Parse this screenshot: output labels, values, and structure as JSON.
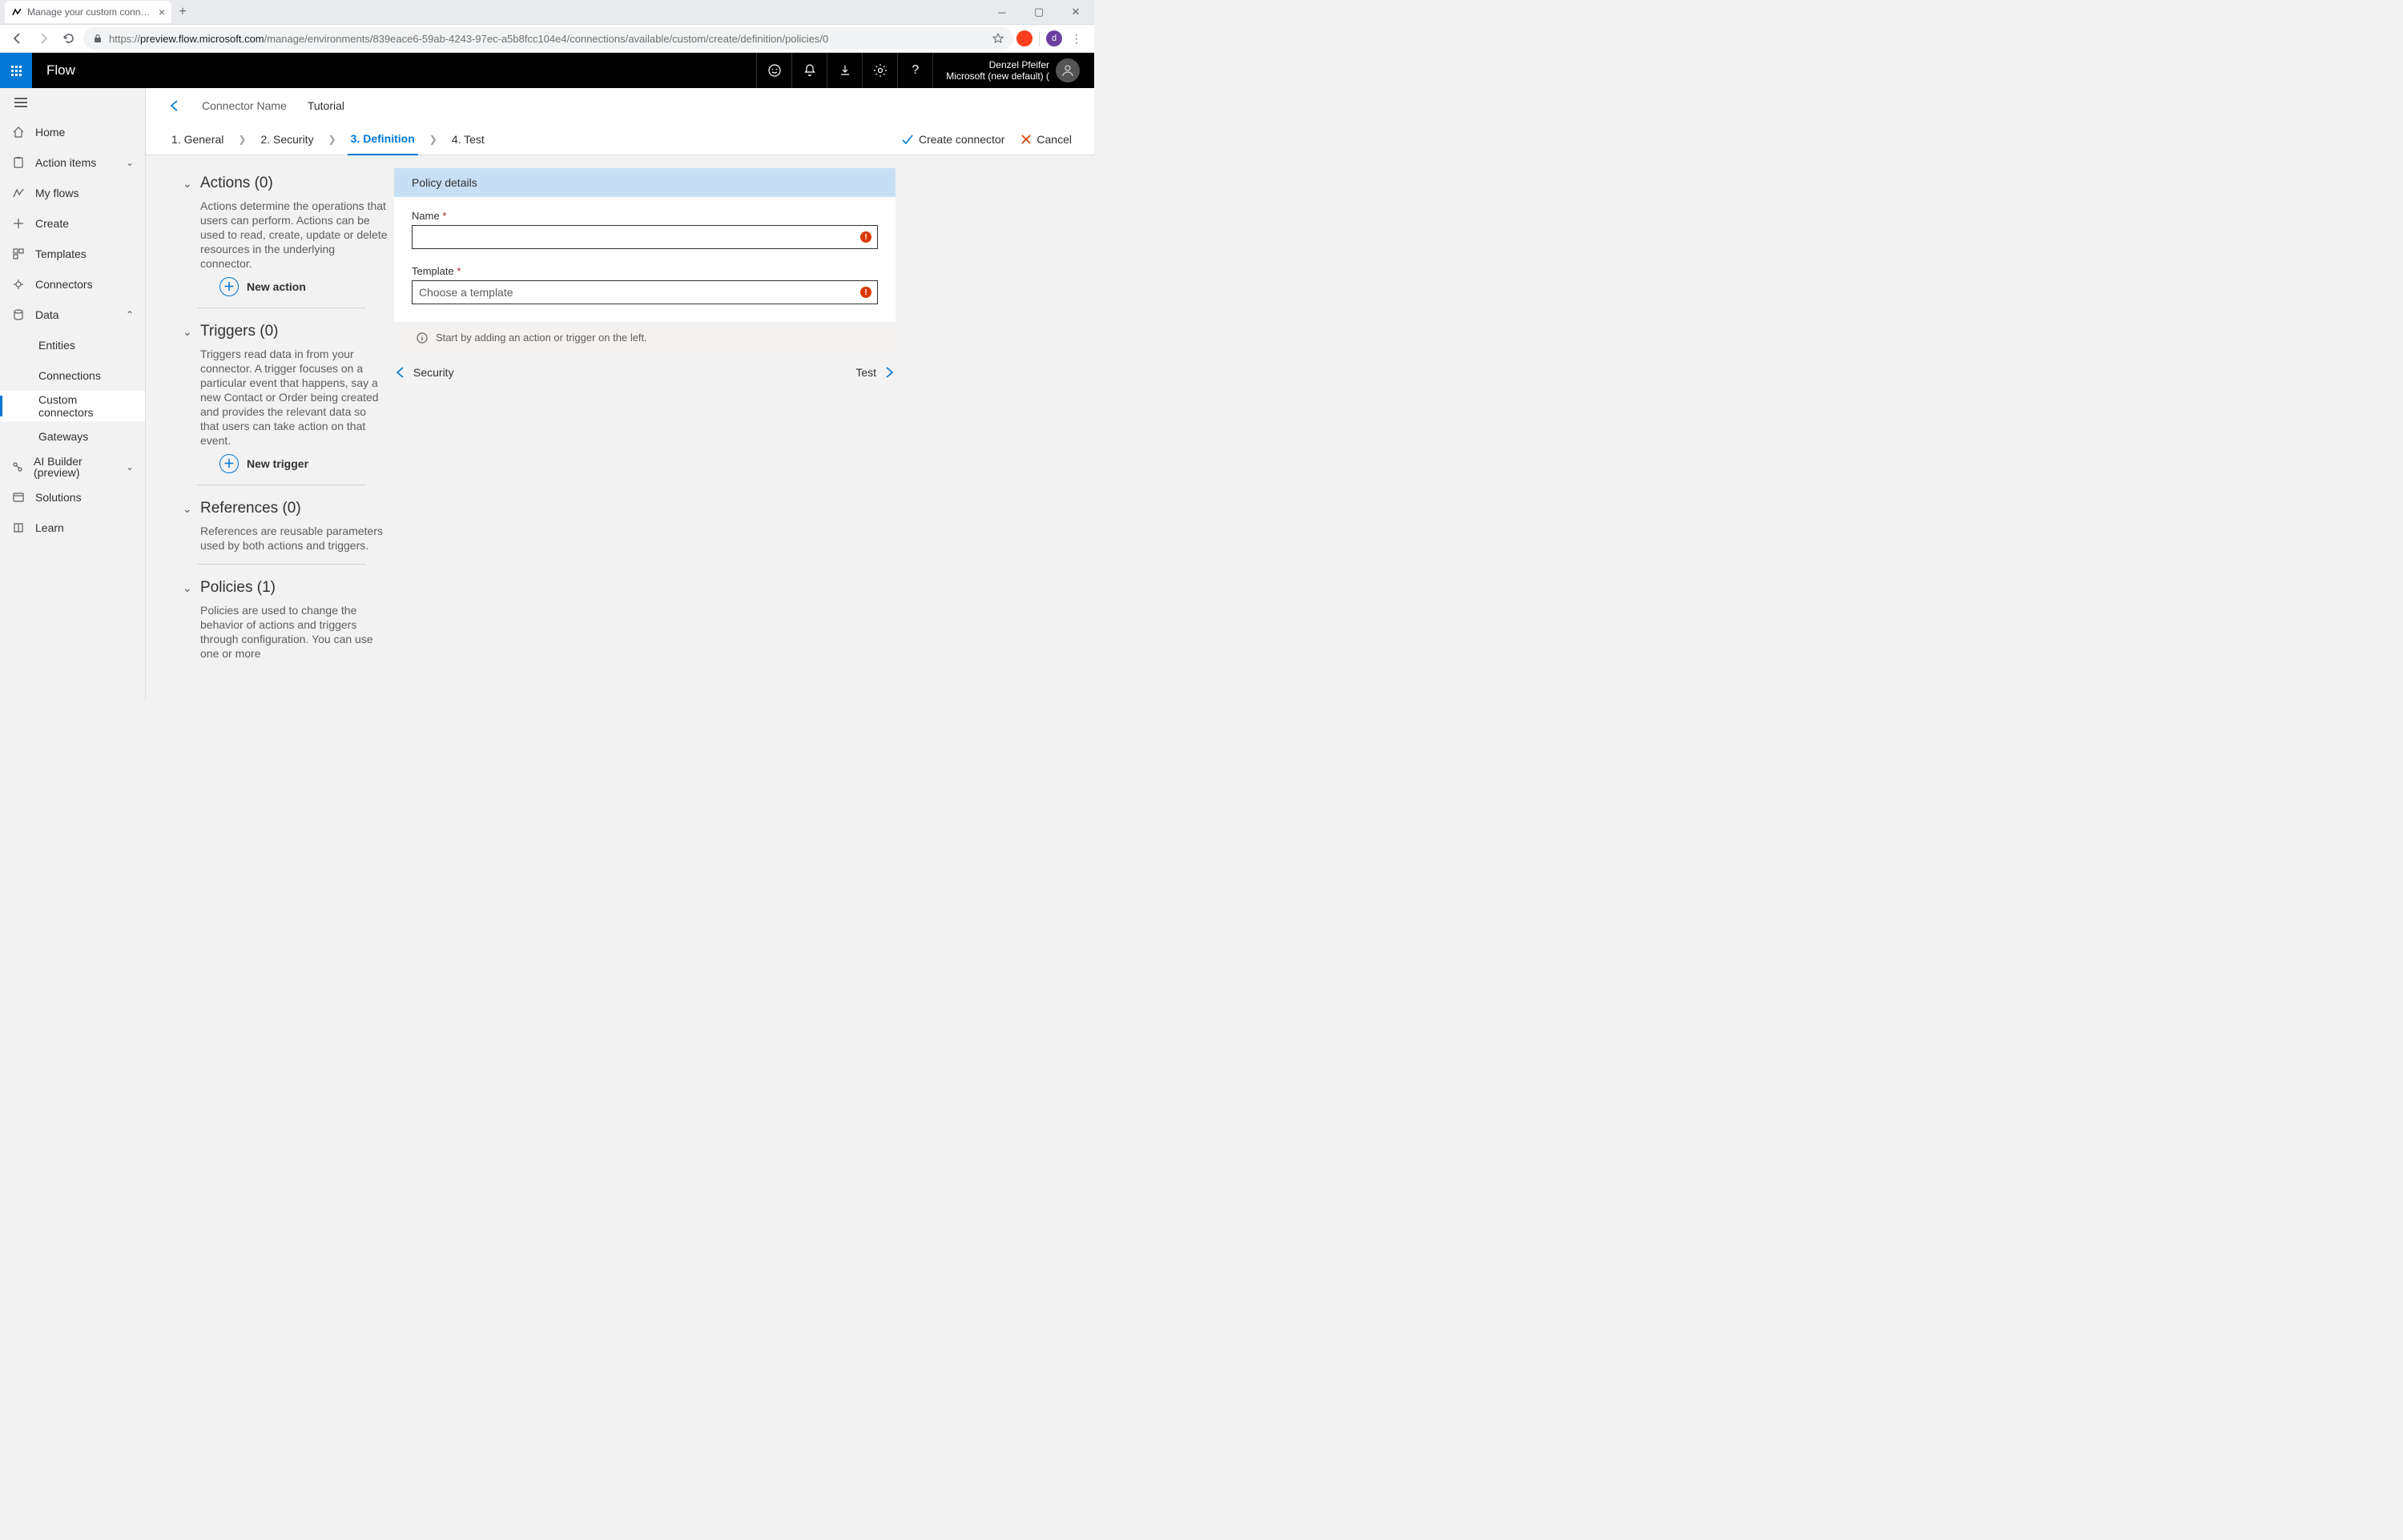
{
  "browser": {
    "tab_title": "Manage your custom connectors",
    "url_prefix": "https://",
    "url_host": "preview.flow.microsoft.com",
    "url_path": "/manage/environments/839eace6-59ab-4243-97ec-a5b8fcc104e4/connections/available/custom/create/definition/policies/0",
    "avatar_initial": "d"
  },
  "header": {
    "app_name": "Flow",
    "user_name": "Denzel Pfeifer",
    "tenant": "Microsoft (new default) ("
  },
  "sidebar": {
    "home": "Home",
    "action_items": "Action items",
    "my_flows": "My flows",
    "create": "Create",
    "templates": "Templates",
    "connectors": "Connectors",
    "data": "Data",
    "entities": "Entities",
    "connections": "Connections",
    "custom_connectors": "Custom connectors",
    "gateways": "Gateways",
    "ai_builder": "AI Builder (preview)",
    "solutions": "Solutions",
    "learn": "Learn"
  },
  "connector": {
    "label": "Connector Name",
    "name": "Tutorial"
  },
  "steps": {
    "s1": "1. General",
    "s2": "2. Security",
    "s3": "3. Definition",
    "s4": "4. Test",
    "create": "Create connector",
    "cancel": "Cancel"
  },
  "defs": {
    "actions_title": "Actions (0)",
    "actions_desc": "Actions determine the operations that users can perform. Actions can be used to read, create, update or delete resources in the underlying connector.",
    "new_action": "New action",
    "triggers_title": "Triggers (0)",
    "triggers_desc": "Triggers read data in from your connector. A trigger focuses on a particular event that happens, say a new Contact or Order being created and provides the relevant data so that users can take action on that event.",
    "new_trigger": "New trigger",
    "references_title": "References (0)",
    "references_desc": "References are reusable parameters used by both actions and triggers.",
    "policies_title": "Policies (1)",
    "policies_desc": "Policies are used to change the behavior of actions and triggers through configuration. You can use one or more"
  },
  "form": {
    "header": "Policy details",
    "name_label": "Name",
    "template_label": "Template",
    "template_placeholder": "Choose a template",
    "hint": "Start by adding an action or trigger on the left."
  },
  "pager": {
    "prev": "Security",
    "next": "Test"
  }
}
